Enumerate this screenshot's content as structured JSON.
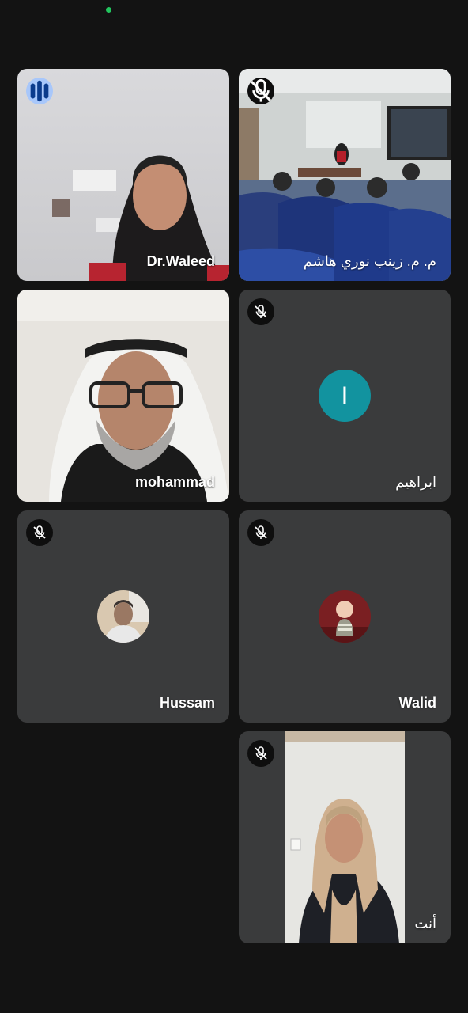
{
  "status_bar": {
    "indicator_color": "#22c55e"
  },
  "participants": [
    {
      "name": "Dr.Waleed",
      "muted": false,
      "speaking": true,
      "video": true
    },
    {
      "name": "م. م. زينب نوري هاشم",
      "muted": true,
      "video": true
    },
    {
      "name": "mohammad",
      "muted": false,
      "video": true
    },
    {
      "name": "ابراهيم",
      "muted": true,
      "video": false,
      "avatar_letter": "I",
      "avatar_color": "#12939f"
    },
    {
      "name": "Hussam",
      "muted": true,
      "video": false,
      "avatar": "photo"
    },
    {
      "name": "Walid",
      "muted": true,
      "video": false,
      "avatar": "photo"
    },
    {
      "name": "أنت",
      "muted": true,
      "video": true
    }
  ],
  "colors": {
    "background": "#131313",
    "tile": "#3a3b3c",
    "speaking_badge": "#a8c7fa",
    "mute_badge": "#0e0e0e"
  }
}
